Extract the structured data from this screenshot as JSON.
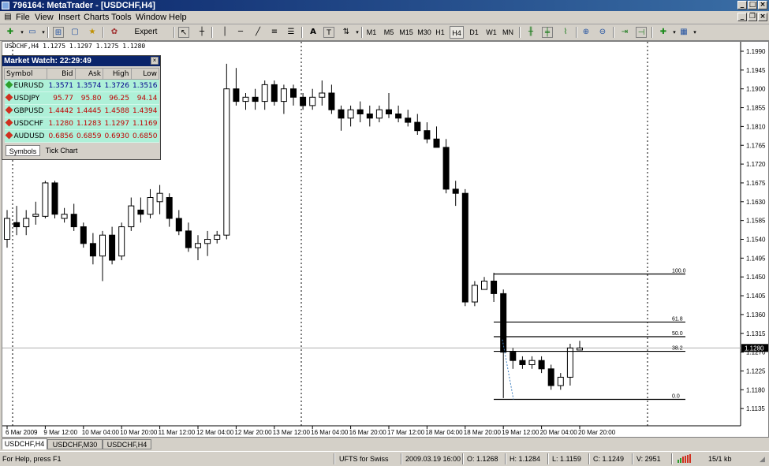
{
  "window": {
    "title": "796164: MetaTrader - [USDCHF,H4]"
  },
  "menu": [
    "File",
    "View",
    "Insert",
    "Charts",
    "Tools",
    "Window",
    "Help"
  ],
  "toolbar": {
    "expert_advisors_label": "Expert Advisors",
    "timeframes": [
      "M1",
      "M5",
      "M15",
      "M30",
      "H1",
      "H4",
      "D1",
      "W1",
      "MN"
    ],
    "active_timeframe": "H4"
  },
  "chart": {
    "symbol_info": "USDCHF,H4  1.1275 1.1297 1.1275 1.1280",
    "current_price_label": "1.1280",
    "price_axis": [
      "1.1990",
      "1.1945",
      "1.1900",
      "1.1855",
      "1.1810",
      "1.1765",
      "1.1720",
      "1.1675",
      "1.1630",
      "1.1585",
      "1.1540",
      "1.1495",
      "1.1450",
      "1.1405",
      "1.1360",
      "1.1315",
      "1.1270",
      "1.1225",
      "1.1180",
      "1.1135"
    ],
    "time_axis": [
      "6 Mar 2009",
      "9 Mar 12:00",
      "10 Mar 04:00",
      "10 Mar 20:00",
      "11 Mar 12:00",
      "12 Mar 04:00",
      "12 Mar 20:00",
      "13 Mar 12:00",
      "16 Mar 04:00",
      "16 Mar 20:00",
      "17 Mar 12:00",
      "18 Mar 04:00",
      "18 Mar 20:00",
      "19 Mar 12:00",
      "20 Mar 04:00",
      "20 Mar 20:00"
    ],
    "fibo_levels": [
      {
        "label": "100.0",
        "price": 1.1457
      },
      {
        "label": "61.8",
        "price": 1.1342
      },
      {
        "label": "50.0",
        "price": 1.1307
      },
      {
        "label": "38.2",
        "price": 1.1272
      },
      {
        "label": "0.0",
        "price": 1.1157
      }
    ],
    "bid_line": 1.128,
    "candles": [
      [
        1.154,
        1.161,
        1.152,
        1.159
      ],
      [
        1.158,
        1.162,
        1.155,
        1.157
      ],
      [
        1.157,
        1.161,
        1.155,
        1.159
      ],
      [
        1.1595,
        1.163,
        1.1575,
        1.16
      ],
      [
        1.1595,
        1.168,
        1.159,
        1.1675
      ],
      [
        1.1675,
        1.168,
        1.159,
        1.16
      ],
      [
        1.159,
        1.1615,
        1.158,
        1.16
      ],
      [
        1.16,
        1.1625,
        1.156,
        1.157
      ],
      [
        1.157,
        1.158,
        1.152,
        1.153
      ],
      [
        1.153,
        1.1555,
        1.148,
        1.15
      ],
      [
        1.15,
        1.156,
        1.144,
        1.155
      ],
      [
        1.155,
        1.157,
        1.148,
        1.149
      ],
      [
        1.15,
        1.158,
        1.149,
        1.157
      ],
      [
        1.157,
        1.164,
        1.156,
        1.162
      ],
      [
        1.161,
        1.164,
        1.158,
        1.16
      ],
      [
        1.16,
        1.166,
        1.159,
        1.164
      ],
      [
        1.163,
        1.167,
        1.16,
        1.165
      ],
      [
        1.164,
        1.165,
        1.157,
        1.159
      ],
      [
        1.159,
        1.161,
        1.155,
        1.156
      ],
      [
        1.156,
        1.158,
        1.151,
        1.152
      ],
      [
        1.152,
        1.155,
        1.149,
        1.153
      ],
      [
        1.153,
        1.156,
        1.15,
        1.154
      ],
      [
        1.154,
        1.156,
        1.153,
        1.155
      ],
      [
        1.155,
        1.196,
        1.154,
        1.19
      ],
      [
        1.19,
        1.195,
        1.186,
        1.187
      ],
      [
        1.187,
        1.189,
        1.185,
        1.188
      ],
      [
        1.188,
        1.19,
        1.185,
        1.187
      ],
      [
        1.187,
        1.192,
        1.185,
        1.191
      ],
      [
        1.191,
        1.192,
        1.186,
        1.187
      ],
      [
        1.187,
        1.191,
        1.184,
        1.19
      ],
      [
        1.19,
        1.191,
        1.186,
        1.188
      ],
      [
        1.188,
        1.189,
        1.185,
        1.186
      ],
      [
        1.186,
        1.19,
        1.185,
        1.188
      ],
      [
        1.188,
        1.192,
        1.186,
        1.189
      ],
      [
        1.189,
        1.191,
        1.184,
        1.185
      ],
      [
        1.185,
        1.186,
        1.18,
        1.183
      ],
      [
        1.183,
        1.186,
        1.181,
        1.185
      ],
      [
        1.185,
        1.187,
        1.182,
        1.184
      ],
      [
        1.184,
        1.186,
        1.181,
        1.183
      ],
      [
        1.183,
        1.186,
        1.182,
        1.185
      ],
      [
        1.185,
        1.189,
        1.183,
        1.184
      ],
      [
        1.184,
        1.186,
        1.182,
        1.183
      ],
      [
        1.183,
        1.185,
        1.181,
        1.182
      ],
      [
        1.182,
        1.184,
        1.179,
        1.18
      ],
      [
        1.18,
        1.182,
        1.177,
        1.178
      ],
      [
        1.178,
        1.181,
        1.176,
        1.176
      ],
      [
        1.176,
        1.178,
        1.165,
        1.166
      ],
      [
        1.166,
        1.168,
        1.162,
        1.165
      ],
      [
        1.165,
        1.166,
        1.138,
        1.139
      ],
      [
        1.139,
        1.144,
        1.138,
        1.143
      ],
      [
        1.142,
        1.145,
        1.142,
        1.144
      ],
      [
        1.144,
        1.146,
        1.139,
        1.141
      ],
      [
        1.141,
        1.142,
        1.116,
        1.127
      ],
      [
        1.127,
        1.128,
        1.123,
        1.125
      ],
      [
        1.125,
        1.126,
        1.123,
        1.124
      ],
      [
        1.124,
        1.126,
        1.123,
        1.125
      ],
      [
        1.125,
        1.126,
        1.122,
        1.123
      ],
      [
        1.123,
        1.124,
        1.118,
        1.119
      ],
      [
        1.119,
        1.122,
        1.118,
        1.121
      ],
      [
        1.121,
        1.129,
        1.119,
        1.128
      ],
      [
        1.1275,
        1.1297,
        1.1275,
        1.128
      ]
    ]
  },
  "market_watch": {
    "title": "Market Watch: 22:29:49",
    "columns": [
      "Symbol",
      "Bid",
      "Ask",
      "High",
      "Low"
    ],
    "rows": [
      {
        "symbol": "EURUSD",
        "bid": "1.3571",
        "ask": "1.3574",
        "high": "1.3726",
        "low": "1.3516",
        "dir": "up"
      },
      {
        "symbol": "USDJPY",
        "bid": "95.77",
        "ask": "95.80",
        "high": "96.25",
        "low": "94.14",
        "dir": "dn"
      },
      {
        "symbol": "GBPUSD",
        "bid": "1.4442",
        "ask": "1.4445",
        "high": "1.4588",
        "low": "1.4394",
        "dir": "dn"
      },
      {
        "symbol": "USDCHF",
        "bid": "1.1280",
        "ask": "1.1283",
        "high": "1.1297",
        "low": "1.1169",
        "dir": "dn"
      },
      {
        "symbol": "AUDUSD",
        "bid": "0.6856",
        "ask": "0.6859",
        "high": "0.6930",
        "low": "0.6850",
        "dir": "dn"
      }
    ],
    "tabs": [
      "Symbols",
      "Tick Chart"
    ]
  },
  "chart_tabs": [
    "USDCHF,H4",
    "USDCHF,M30",
    "USDCHF,H4"
  ],
  "status": {
    "help": "For Help, press F1",
    "profile": "UFTS for Swiss",
    "datetime": "2009.03.19 16:00",
    "open": "O: 1.1268",
    "high": "H: 1.1284",
    "low": "L: 1.1159",
    "close": "C: 1.1249",
    "volume": "V: 2951",
    "traffic": "15/1 kb"
  },
  "colors": {
    "title_bar": "#0a246a",
    "market_watch_row": "#aef0d8",
    "chart_bg": "#ffffff",
    "candle": "#000000"
  }
}
